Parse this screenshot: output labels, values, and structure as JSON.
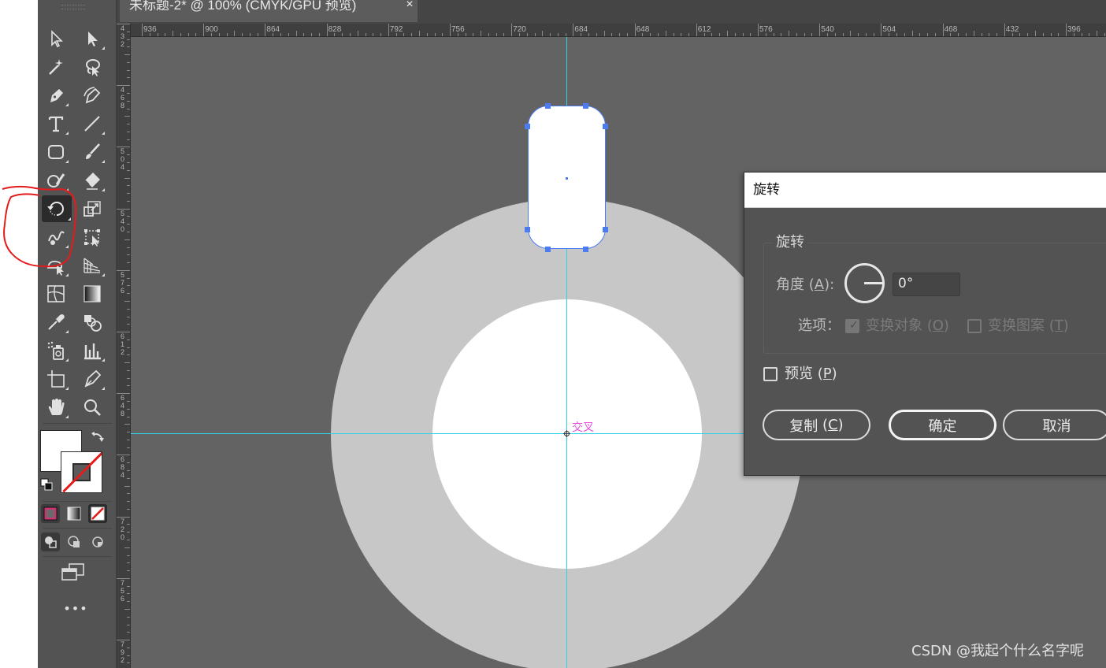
{
  "document": {
    "tab_title": "未标题-2* @ 100% (CMYK/GPU 预览)",
    "close_label": "×"
  },
  "ruler": {
    "horizontal_labels": [
      "936",
      "900",
      "864",
      "828",
      "792",
      "756",
      "720",
      "684",
      "648",
      "612",
      "576",
      "540",
      "504",
      "468",
      "432",
      "396"
    ],
    "vertical_labels": [
      "432",
      "468",
      "504",
      "540",
      "576",
      "612",
      "648",
      "684",
      "720",
      "756",
      "792"
    ]
  },
  "canvas": {
    "intersect_label": "交叉"
  },
  "toolbar": {
    "tools": [
      {
        "name": "selection-tool",
        "icon": "selection-arrow-icon"
      },
      {
        "name": "direct-selection-tool",
        "icon": "direct-selection-icon"
      },
      {
        "name": "magic-wand-tool",
        "icon": "magic-wand-icon"
      },
      {
        "name": "lasso-tool",
        "icon": "lasso-icon"
      },
      {
        "name": "pen-tool",
        "icon": "pen-icon"
      },
      {
        "name": "curvature-tool",
        "icon": "curvature-pen-icon"
      },
      {
        "name": "type-tool",
        "icon": "type-icon"
      },
      {
        "name": "line-segment-tool",
        "icon": "line-icon"
      },
      {
        "name": "rectangle-tool",
        "icon": "rounded-rectangle-icon"
      },
      {
        "name": "paintbrush-tool",
        "icon": "paintbrush-icon"
      },
      {
        "name": "shaper-tool",
        "icon": "shaper-icon"
      },
      {
        "name": "eraser-tool",
        "icon": "eraser-icon"
      },
      {
        "name": "rotate-tool",
        "icon": "rotate-icon"
      },
      {
        "name": "scale-tool",
        "icon": "scale-icon"
      },
      {
        "name": "warp-tool",
        "icon": "warp-icon"
      },
      {
        "name": "free-transform-tool",
        "icon": "free-transform-icon"
      },
      {
        "name": "shape-builder-tool",
        "icon": "shape-builder-icon"
      },
      {
        "name": "perspective-grid-tool",
        "icon": "perspective-grid-icon"
      },
      {
        "name": "mesh-tool",
        "icon": "mesh-icon"
      },
      {
        "name": "gradient-tool",
        "icon": "gradient-icon"
      },
      {
        "name": "eyedropper-tool",
        "icon": "eyedropper-icon"
      },
      {
        "name": "blend-tool",
        "icon": "blend-icon"
      },
      {
        "name": "symbol-sprayer-tool",
        "icon": "symbol-sprayer-icon"
      },
      {
        "name": "column-graph-tool",
        "icon": "column-graph-icon"
      },
      {
        "name": "artboard-tool",
        "icon": "artboard-icon"
      },
      {
        "name": "slice-tool",
        "icon": "slice-icon"
      },
      {
        "name": "hand-tool",
        "icon": "hand-icon"
      },
      {
        "name": "zoom-tool",
        "icon": "zoom-icon"
      }
    ],
    "active_tool": "rotate-tool",
    "more_label": "•••"
  },
  "colors": {
    "fill": "#ffffff",
    "stroke": "none",
    "guide": "#2ed3e8",
    "selection": "#4c7cf3",
    "smart_guide_label": "#e44fe0",
    "annotation": "#e51b1b"
  },
  "dialog": {
    "title": "旋转",
    "group_label": "旋转",
    "angle_label": "角度",
    "angle_key": "A",
    "angle_value": "0°",
    "options_label": "选项：",
    "transform_objects_label": "变换对象",
    "transform_objects_key": "O",
    "transform_objects_checked": true,
    "transform_patterns_label": "变换图案",
    "transform_patterns_key": "T",
    "transform_patterns_checked": false,
    "preview_label": "预览",
    "preview_key": "P",
    "preview_checked": false,
    "copy_label": "复制",
    "copy_key": "C",
    "ok_label": "确定",
    "cancel_label": "取消"
  },
  "watermark": "CSDN @我起个什么名字呢"
}
